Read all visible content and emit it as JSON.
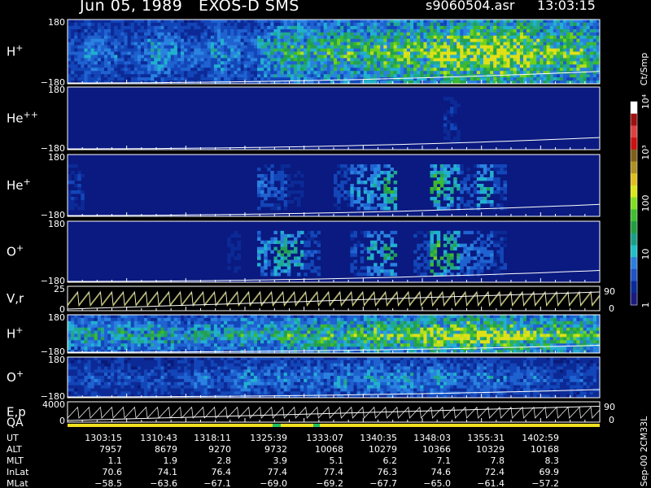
{
  "header": {
    "title": "Jun 05, 1989   EXOS-D SMS",
    "file": "s9060504.asr",
    "time": "13:03:15"
  },
  "chart_data": {
    "type": "heatmap",
    "panels": [
      {
        "id": "h_plus",
        "label": "H",
        "sup": "+",
        "ytop": "180",
        "ybot": "−180",
        "ylim": [
          -180,
          180
        ],
        "activity": [
          0.25,
          0.35,
          0.3,
          0.25,
          0.3,
          0.4,
          0.35,
          0.3,
          0.3,
          0.4,
          0.35,
          0.3,
          0.45,
          0.55,
          0.6,
          0.55,
          0.6,
          0.65,
          0.6,
          0.65,
          0.7,
          0.75,
          0.7,
          0.8,
          0.85,
          0.8,
          0.85,
          0.9,
          0.85,
          0.8,
          0.75,
          0.7,
          0.75,
          0.6
        ]
      },
      {
        "id": "he_pp",
        "label": "He",
        "sup": "++",
        "ytop": "180",
        "ybot": "−180",
        "ylim": [
          -180,
          180
        ],
        "activity": [
          0,
          0,
          0,
          0,
          0,
          0,
          0,
          0,
          0,
          0,
          0,
          0,
          0,
          0,
          0,
          0,
          0,
          0,
          0,
          0,
          0,
          0,
          0,
          0,
          0.15,
          0,
          0,
          0,
          0,
          0,
          0,
          0,
          0,
          0
        ]
      },
      {
        "id": "he_plus",
        "label": "He",
        "sup": "+",
        "ytop": "180",
        "ybot": "−180",
        "ylim": [
          -180,
          180
        ],
        "activity": [
          0.15,
          0.05,
          0,
          0,
          0,
          0,
          0,
          0,
          0,
          0,
          0,
          0,
          0.25,
          0.2,
          0.1,
          0,
          0,
          0.2,
          0.35,
          0.4,
          0.5,
          0,
          0,
          0.55,
          0.45,
          0.2,
          0.45,
          0.2,
          0,
          0,
          0,
          0,
          0,
          0
        ]
      },
      {
        "id": "o_plus",
        "label": "O",
        "sup": "+",
        "ytop": "180",
        "ybot": "−180",
        "ylim": [
          -180,
          180
        ],
        "activity": [
          0.05,
          0,
          0,
          0,
          0,
          0,
          0,
          0,
          0,
          0,
          0.1,
          0,
          0.35,
          0.5,
          0.45,
          0.2,
          0.05,
          0.05,
          0.2,
          0.4,
          0.45,
          0,
          0.2,
          0.6,
          0.5,
          0.3,
          0.25,
          0.15,
          0,
          0.05,
          0,
          0,
          0,
          0
        ]
      },
      {
        "id": "vr",
        "label": "V,r",
        "sup": "",
        "ytop": "25",
        "ybot": "0",
        "ylim": [
          0,
          25
        ],
        "right_top": "90",
        "right_bot": "0"
      },
      {
        "id": "h_plus2",
        "label": "H",
        "sup": "+",
        "ytop": "180",
        "ybot": "−180",
        "ylim": [
          -180,
          180
        ],
        "activity": [
          0.45,
          0.5,
          0.45,
          0.5,
          0.45,
          0.5,
          0.5,
          0.45,
          0.5,
          0.45,
          0.5,
          0.55,
          0.5,
          0.55,
          0.6,
          0.6,
          0.65,
          0.6,
          0.65,
          0.7,
          0.65,
          0.7,
          0.75,
          0.8,
          0.8,
          0.85,
          0.8,
          0.75,
          0.8,
          0.75,
          0.7,
          0.7,
          0.65,
          0.6
        ]
      },
      {
        "id": "o_plus2",
        "label": "O",
        "sup": "+",
        "ytop": "180",
        "ybot": "−180",
        "ylim": [
          -180,
          180
        ],
        "activity": [
          0.2,
          0.25,
          0.2,
          0.25,
          0.2,
          0.25,
          0.2,
          0.25,
          0.3,
          0.25,
          0.3,
          0.35,
          0.3,
          0.35,
          0.3,
          0.35,
          0.3,
          0.4,
          0.35,
          0.4,
          0.35,
          0.4,
          0.35,
          0.4,
          0.35,
          0.3,
          0.35,
          0.3,
          0.25,
          0.3,
          0.25,
          0.2,
          0.25,
          0.2
        ]
      },
      {
        "id": "ep",
        "label": "E,p",
        "sup": "",
        "ytop": "4000",
        "ybot": "0",
        "ylim": [
          0,
          4000
        ],
        "right_top": "90",
        "right_bot": "0"
      }
    ],
    "qa_label": "QA",
    "colorbar": {
      "title": "Ct/Smp",
      "scale": "log",
      "range": [
        1,
        10000
      ],
      "ticks": [
        {
          "text": "1",
          "value": 1
        },
        {
          "text": "10",
          "value": 10
        },
        {
          "text": "100",
          "value": 100
        },
        {
          "text": "10³",
          "value": 1000
        },
        {
          "text": "10⁴",
          "value": 10000
        }
      ],
      "colors": [
        "#1a1a80",
        "#0a2a9a",
        "#1f52c8",
        "#2b7fe0",
        "#20c0c8",
        "#18a088",
        "#20a040",
        "#40c030",
        "#80e020",
        "#d8e818",
        "#e0c020",
        "#b09020",
        "#80601a",
        "#d01010",
        "#e04040",
        "#a01010",
        "#ffffff"
      ]
    },
    "x_ticks": [
      "1303:15",
      "1310:43",
      "1318:11",
      "1325:39",
      "1333:07",
      "1340:35",
      "1348:03",
      "1355:31",
      "1402:59"
    ],
    "orbit_table": {
      "rows": [
        {
          "name": "UT",
          "values": [
            "1303:15",
            "1310:43",
            "1318:11",
            "1325:39",
            "1333:07",
            "1340:35",
            "1348:03",
            "1355:31",
            "1402:59"
          ]
        },
        {
          "name": "ALT",
          "values": [
            "7957",
            "8679",
            "9270",
            "9732",
            "10068",
            "10279",
            "10366",
            "10329",
            "10168"
          ]
        },
        {
          "name": "MLT",
          "values": [
            "1.1",
            "1.9",
            "2.8",
            "3.9",
            "5.1",
            "6.2",
            "7.1",
            "7.8",
            "8.3"
          ]
        },
        {
          "name": "InLat",
          "values": [
            "70.6",
            "74.1",
            "76.4",
            "77.4",
            "77.4",
            "76.3",
            "74.6",
            "72.4",
            "69.9"
          ]
        },
        {
          "name": "MLat",
          "values": [
            "−58.5",
            "−63.6",
            "−67.1",
            "−69.0",
            "−69.2",
            "−67.7",
            "−65.0",
            "−61.4",
            "−57.2"
          ]
        }
      ]
    },
    "footer_version": "Sep-00 2CM33L"
  }
}
